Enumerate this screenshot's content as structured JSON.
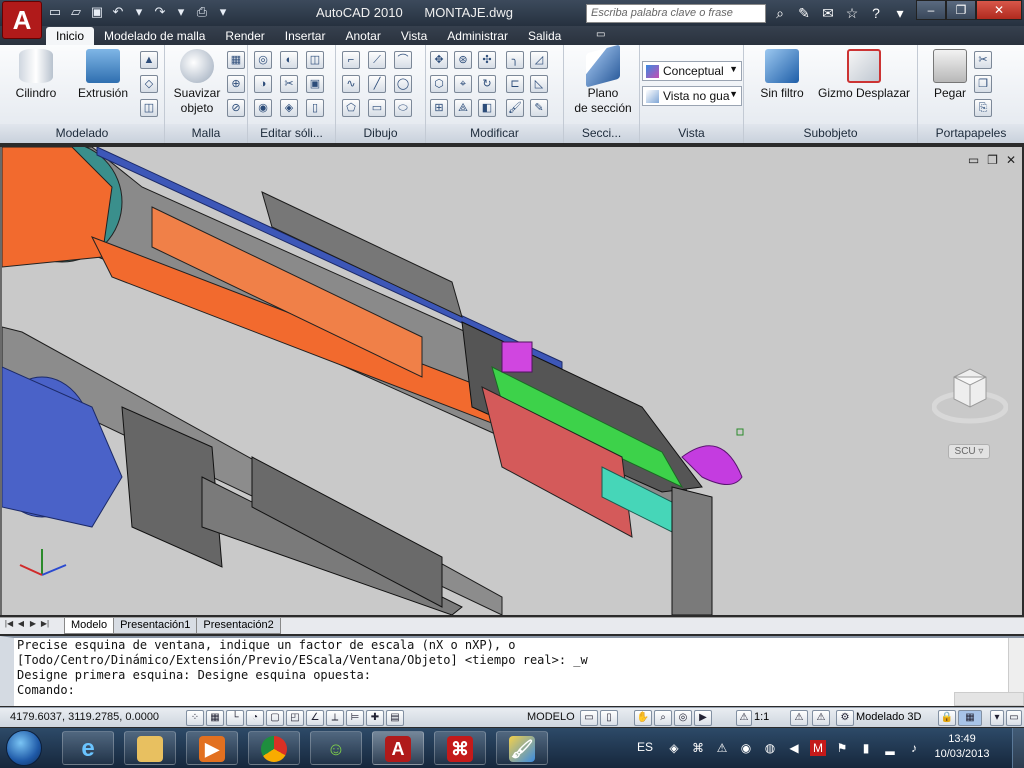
{
  "window": {
    "app_name": "AutoCAD 2010",
    "file_name": "MONTAJE.dwg",
    "search_placeholder": "Escriba palabra clave o frase"
  },
  "ribbon_tabs": [
    "Inicio",
    "Modelado de malla",
    "Render",
    "Insertar",
    "Anotar",
    "Vista",
    "Administrar",
    "Salida"
  ],
  "ribbon": {
    "modelado": {
      "title": "Modelado",
      "cilindro": "Cilindro",
      "extrusion": "Extrusión"
    },
    "malla": {
      "title": "Malla",
      "suavizar1": "Suavizar",
      "suavizar2": "objeto"
    },
    "editar": {
      "title": "Editar sóli..."
    },
    "dibujo": {
      "title": "Dibujo"
    },
    "modificar": {
      "title": "Modificar"
    },
    "seccion": {
      "title": "Secci...",
      "plano1": "Plano",
      "plano2": "de sección"
    },
    "vista": {
      "title": "Vista",
      "visual_style": "Conceptual",
      "view_combo": "Vista no gua"
    },
    "subobjeto": {
      "title": "Subobjeto",
      "filter": "Sin filtro",
      "gizmo": "Gizmo Desplazar"
    },
    "portapapeles": {
      "title": "Portapapeles",
      "paste": "Pegar"
    }
  },
  "viewport": {
    "ucs_label": "SCU"
  },
  "layout_tabs": [
    "Modelo",
    "Presentación1",
    "Presentación2"
  ],
  "command": {
    "lines": [
      "Precise esquina de ventana, indique un factor de escala (nX o nXP), o",
      "[Todo/Centro/Dinámico/Extensión/Previo/EScala/Ventana/Objeto] <tiempo real>: _w",
      "Designe primera esquina: Designe esquina opuesta:"
    ],
    "prompt": "Comando:"
  },
  "status": {
    "coordinates": "4179.6037, 3119.2785, 0.0000",
    "model": "MODELO",
    "scale": "1:1",
    "workspace": "Modelado 3D"
  },
  "taskbar": {
    "language": "ES",
    "time": "13:49",
    "date": "10/03/2013"
  }
}
